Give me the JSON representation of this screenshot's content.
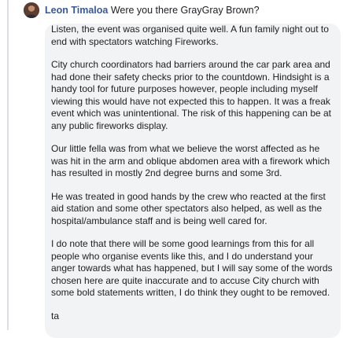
{
  "comment": {
    "author": "Leon Timaloa",
    "header_text": " Were you there GrayGray Brown?",
    "paragraphs": [
      "Listen, the event was organised quite well. A fun family night out to end with spectators watching Fireworks.",
      "City church coordinators had barriers around the car park area and had done their safety checks prior to the countdown. Hindsight is a handy tool for future purposes however, people including myself viewing this would have not expected this to happen. It was a freak event which was unintentional. The risk of this happening can be at any public fireworks display.",
      "Our little fella was from what we believe the worst affected as he was hit in the arm and oblique abdomen area with a firework which has resulted in mostly 2nd degree burns and some 3rd.",
      "He was treated in good hands by the crew who reacted at the first aid station and some other spectators also helped, as well as the hospital/ambulance staff and is being well cared for.",
      "I do note that there will be some good learnings from this for all people who organise events like this, and I do understand your anger towards what has happened, but I will say some of the words chosen here are quite inaccurate and to accuse City church with some bold statements written, I do think they ought to be removed.",
      "ta"
    ]
  },
  "colors": {
    "author_link": "#385898",
    "text": "#1c1e21",
    "bubble_bg": "#f2f3f5",
    "thread_line": "#dcdfe5"
  },
  "icons": {
    "avatar": "profile-avatar"
  }
}
